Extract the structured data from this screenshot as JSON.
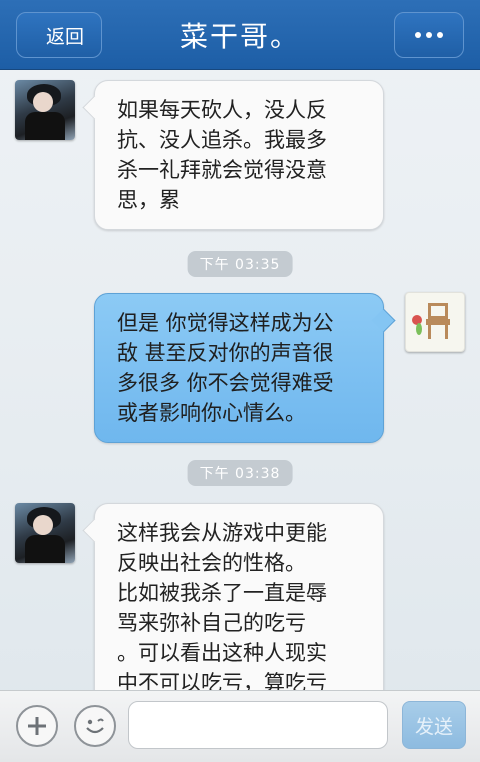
{
  "header": {
    "back_label": "返回",
    "title": "菜干哥。",
    "more_icon": "more-dots-icon"
  },
  "messages": [
    {
      "direction": "incoming",
      "sender_avatar": "avatar-contact",
      "text": "如果每天砍人，没人反\n抗、没人追杀。我最多\n杀一礼拜就会觉得没意\n思，累"
    },
    {
      "type": "timestamp",
      "text": "下午 03:35"
    },
    {
      "direction": "outgoing",
      "sender_avatar": "avatar-self",
      "text": "但是 你觉得这样成为公\n敌 甚至反对你的声音很\n多很多 你不会觉得难受\n或者影响你心情么。"
    },
    {
      "type": "timestamp",
      "text": "下午 03:38"
    },
    {
      "direction": "incoming",
      "sender_avatar": "avatar-contact",
      "text": "这样我会从游戏中更能\n反映出社会的性格。\n比如被我杀了一直是辱\n骂来弥补自己的吃亏\n。可以看出这种人现实\n中不可以吃亏，算吃亏"
    }
  ],
  "input_bar": {
    "plus_icon": "plus-icon",
    "emoji_icon": "emoji-icon",
    "input_value": "",
    "input_placeholder": "",
    "send_label": "发送"
  },
  "colors": {
    "header": "#1d5ea6",
    "outgoing_bubble": "#7abdf0",
    "incoming_bubble": "#fafafa",
    "timestamp_bg": "#c4cbd1"
  }
}
